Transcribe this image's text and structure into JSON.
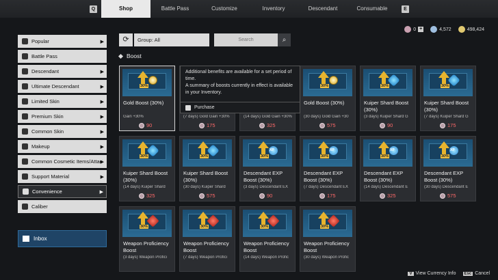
{
  "top_nav": {
    "left_key": "Q",
    "right_key": "E",
    "tabs": [
      {
        "label": "Shop"
      },
      {
        "label": "Battle Pass"
      },
      {
        "label": "Customize"
      },
      {
        "label": "Inventory"
      },
      {
        "label": "Descendant"
      },
      {
        "label": "Consumable"
      }
    ]
  },
  "currencies": [
    {
      "value": "0",
      "icon": "caliber-icon",
      "color": "#c9a0b0"
    },
    {
      "value": "4,572",
      "icon": "gem-icon",
      "color": "#9fbfe0"
    },
    {
      "value": "498,424",
      "icon": "gold-icon",
      "color": "#e0c870"
    }
  ],
  "sidebar": {
    "items": [
      {
        "label": "Popular",
        "icon": "star-icon"
      },
      {
        "label": "Battle Pass",
        "icon": "battle-pass-icon"
      },
      {
        "label": "Descendant",
        "icon": "descendant-icon"
      },
      {
        "label": "Ultimate Descendant",
        "icon": "ultimate-icon"
      },
      {
        "label": "Limited Skin",
        "icon": "limited-skin-icon"
      },
      {
        "label": "Premium Skin",
        "icon": "premium-skin-icon"
      },
      {
        "label": "Common Skin",
        "icon": "common-skin-icon"
      },
      {
        "label": "Makeup",
        "icon": "makeup-icon"
      },
      {
        "label": "Common Cosmetic Items/Attachments",
        "icon": "cosmetic-icon"
      },
      {
        "label": "Support Material",
        "icon": "support-icon"
      },
      {
        "label": "Convenience",
        "icon": "convenience-icon"
      },
      {
        "label": "Caliber",
        "icon": "caliber-icon"
      }
    ],
    "inbox_label": "Inbox"
  },
  "toolbar": {
    "group_label": "Group: All",
    "search_placeholder": "Search"
  },
  "section_title": "Boost",
  "tooltip": {
    "line1": "Additional benefits are available for a set period of time.",
    "line2": "A summary of boosts currently in effect is available in your Inventory.",
    "purchase_label": "Purchase"
  },
  "cards": [
    {
      "name": "Gold Boost (30%)",
      "sub": "Gain +30%",
      "price": "90",
      "token": "gold"
    },
    {
      "name": "Gold Boost (30%)",
      "sub": "(7 days) Gold Gain +30%",
      "price": "175",
      "token": "gold"
    },
    {
      "name": "Gold Boost (30%)",
      "sub": "(14 days) Gold Gain +30%",
      "price": "325",
      "token": "gold"
    },
    {
      "name": "Gold Boost (30%)",
      "sub": "(30 days) Gold Gain +30",
      "price": "575",
      "token": "gold"
    },
    {
      "name": "Kuiper Shard Boost (30%)",
      "sub": "(3 days) Kuiper Shard G",
      "price": "90",
      "token": "kuiper"
    },
    {
      "name": "Kuiper Shard Boost (30%)",
      "sub": "(7 days) Kuiper Shard G",
      "price": "175",
      "token": "kuiper"
    },
    {
      "name": "Kuiper Shard Boost (30%)",
      "sub": "(14 days) Kuiper Shard",
      "price": "325",
      "token": "kuiper"
    },
    {
      "name": "Kuiper Shard Boost (30%)",
      "sub": "(30 days) Kuiper Shard",
      "price": "575",
      "token": "kuiper"
    },
    {
      "name": "Descendant EXP Boost (30%)",
      "sub": "(3 days) Descendant EX",
      "price": "90",
      "token": "exp"
    },
    {
      "name": "Descendant EXP Boost (30%)",
      "sub": "(7 days) Descendant EX",
      "price": "175",
      "token": "exp"
    },
    {
      "name": "Descendant EXP Boost (30%)",
      "sub": "(14 days) Descendant E",
      "price": "325",
      "token": "exp"
    },
    {
      "name": "Descendant EXP Boost (30%)",
      "sub": "(30 days) Descendant E",
      "price": "575",
      "token": "exp"
    },
    {
      "name": "Weapon Proficiency Boost",
      "sub": "(3 days) Weapon Profici",
      "price": "",
      "token": "weapon"
    },
    {
      "name": "Weapon Proficiency Boost",
      "sub": "(7 days) Weapon Profici",
      "price": "",
      "token": "weapon"
    },
    {
      "name": "Weapon Proficiency Boost",
      "sub": "(14 days) Weapon Profic",
      "price": "",
      "token": "weapon"
    },
    {
      "name": "Weapon Proficiency Boost",
      "sub": "(30 days) Weapon Profic",
      "price": "",
      "token": "weapon"
    }
  ],
  "footer": {
    "currency_key": "V",
    "currency_label": "View Currency Info",
    "cancel_key": "Esc",
    "cancel_label": "Cancel"
  }
}
